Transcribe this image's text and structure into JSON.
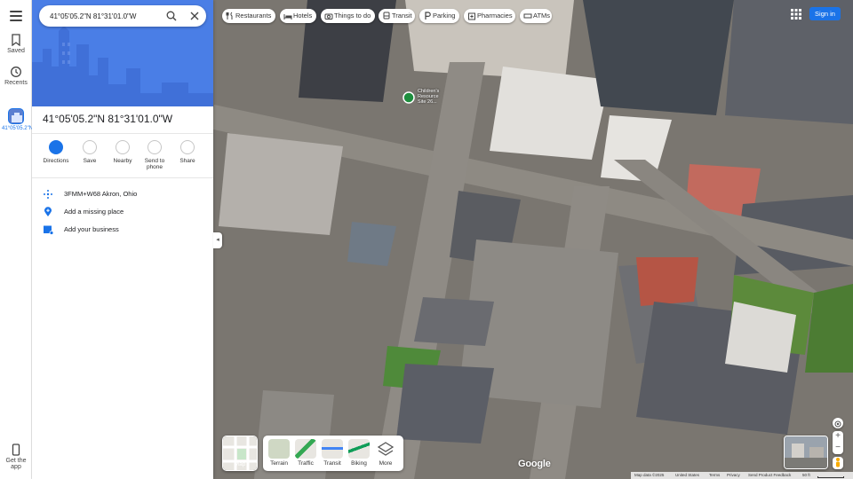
{
  "search": {
    "value": "41°05'05.2\"N 81°31'01.0\"W"
  },
  "rail": {
    "saved": "Saved",
    "recents": "Recents",
    "place_label": "41°05'05.2\"N",
    "get_app": "Get the app"
  },
  "place": {
    "title": "41°05'05.2\"N 81°31'01.0\"W",
    "actions": [
      "Directions",
      "Save",
      "Nearby",
      "Send to phone",
      "Share"
    ],
    "plus_code": "3FMM+W68 Akron, Ohio",
    "add_missing": "Add a missing place",
    "add_business": "Add your business"
  },
  "chips": [
    "Restaurants",
    "Hotels",
    "Things to do",
    "Transit",
    "Parking",
    "Pharmacies",
    "ATMs"
  ],
  "header": {
    "signin": "Sign in"
  },
  "layers": {
    "current": "Map",
    "items": [
      "Terrain",
      "Traffic",
      "Transit",
      "Biking",
      "More"
    ]
  },
  "footer": {
    "map_data": "Map data ©2025",
    "country": "United States",
    "terms": "Terms",
    "privacy": "Privacy",
    "feedback": "Send Product Feedback",
    "scale": "50 ft"
  },
  "map_labels": {
    "poi_lines": [
      "Children's",
      "Resource",
      "Site 26..."
    ]
  },
  "colors": {
    "accent": "#1a73e8",
    "hero": "#4a7ee6"
  }
}
